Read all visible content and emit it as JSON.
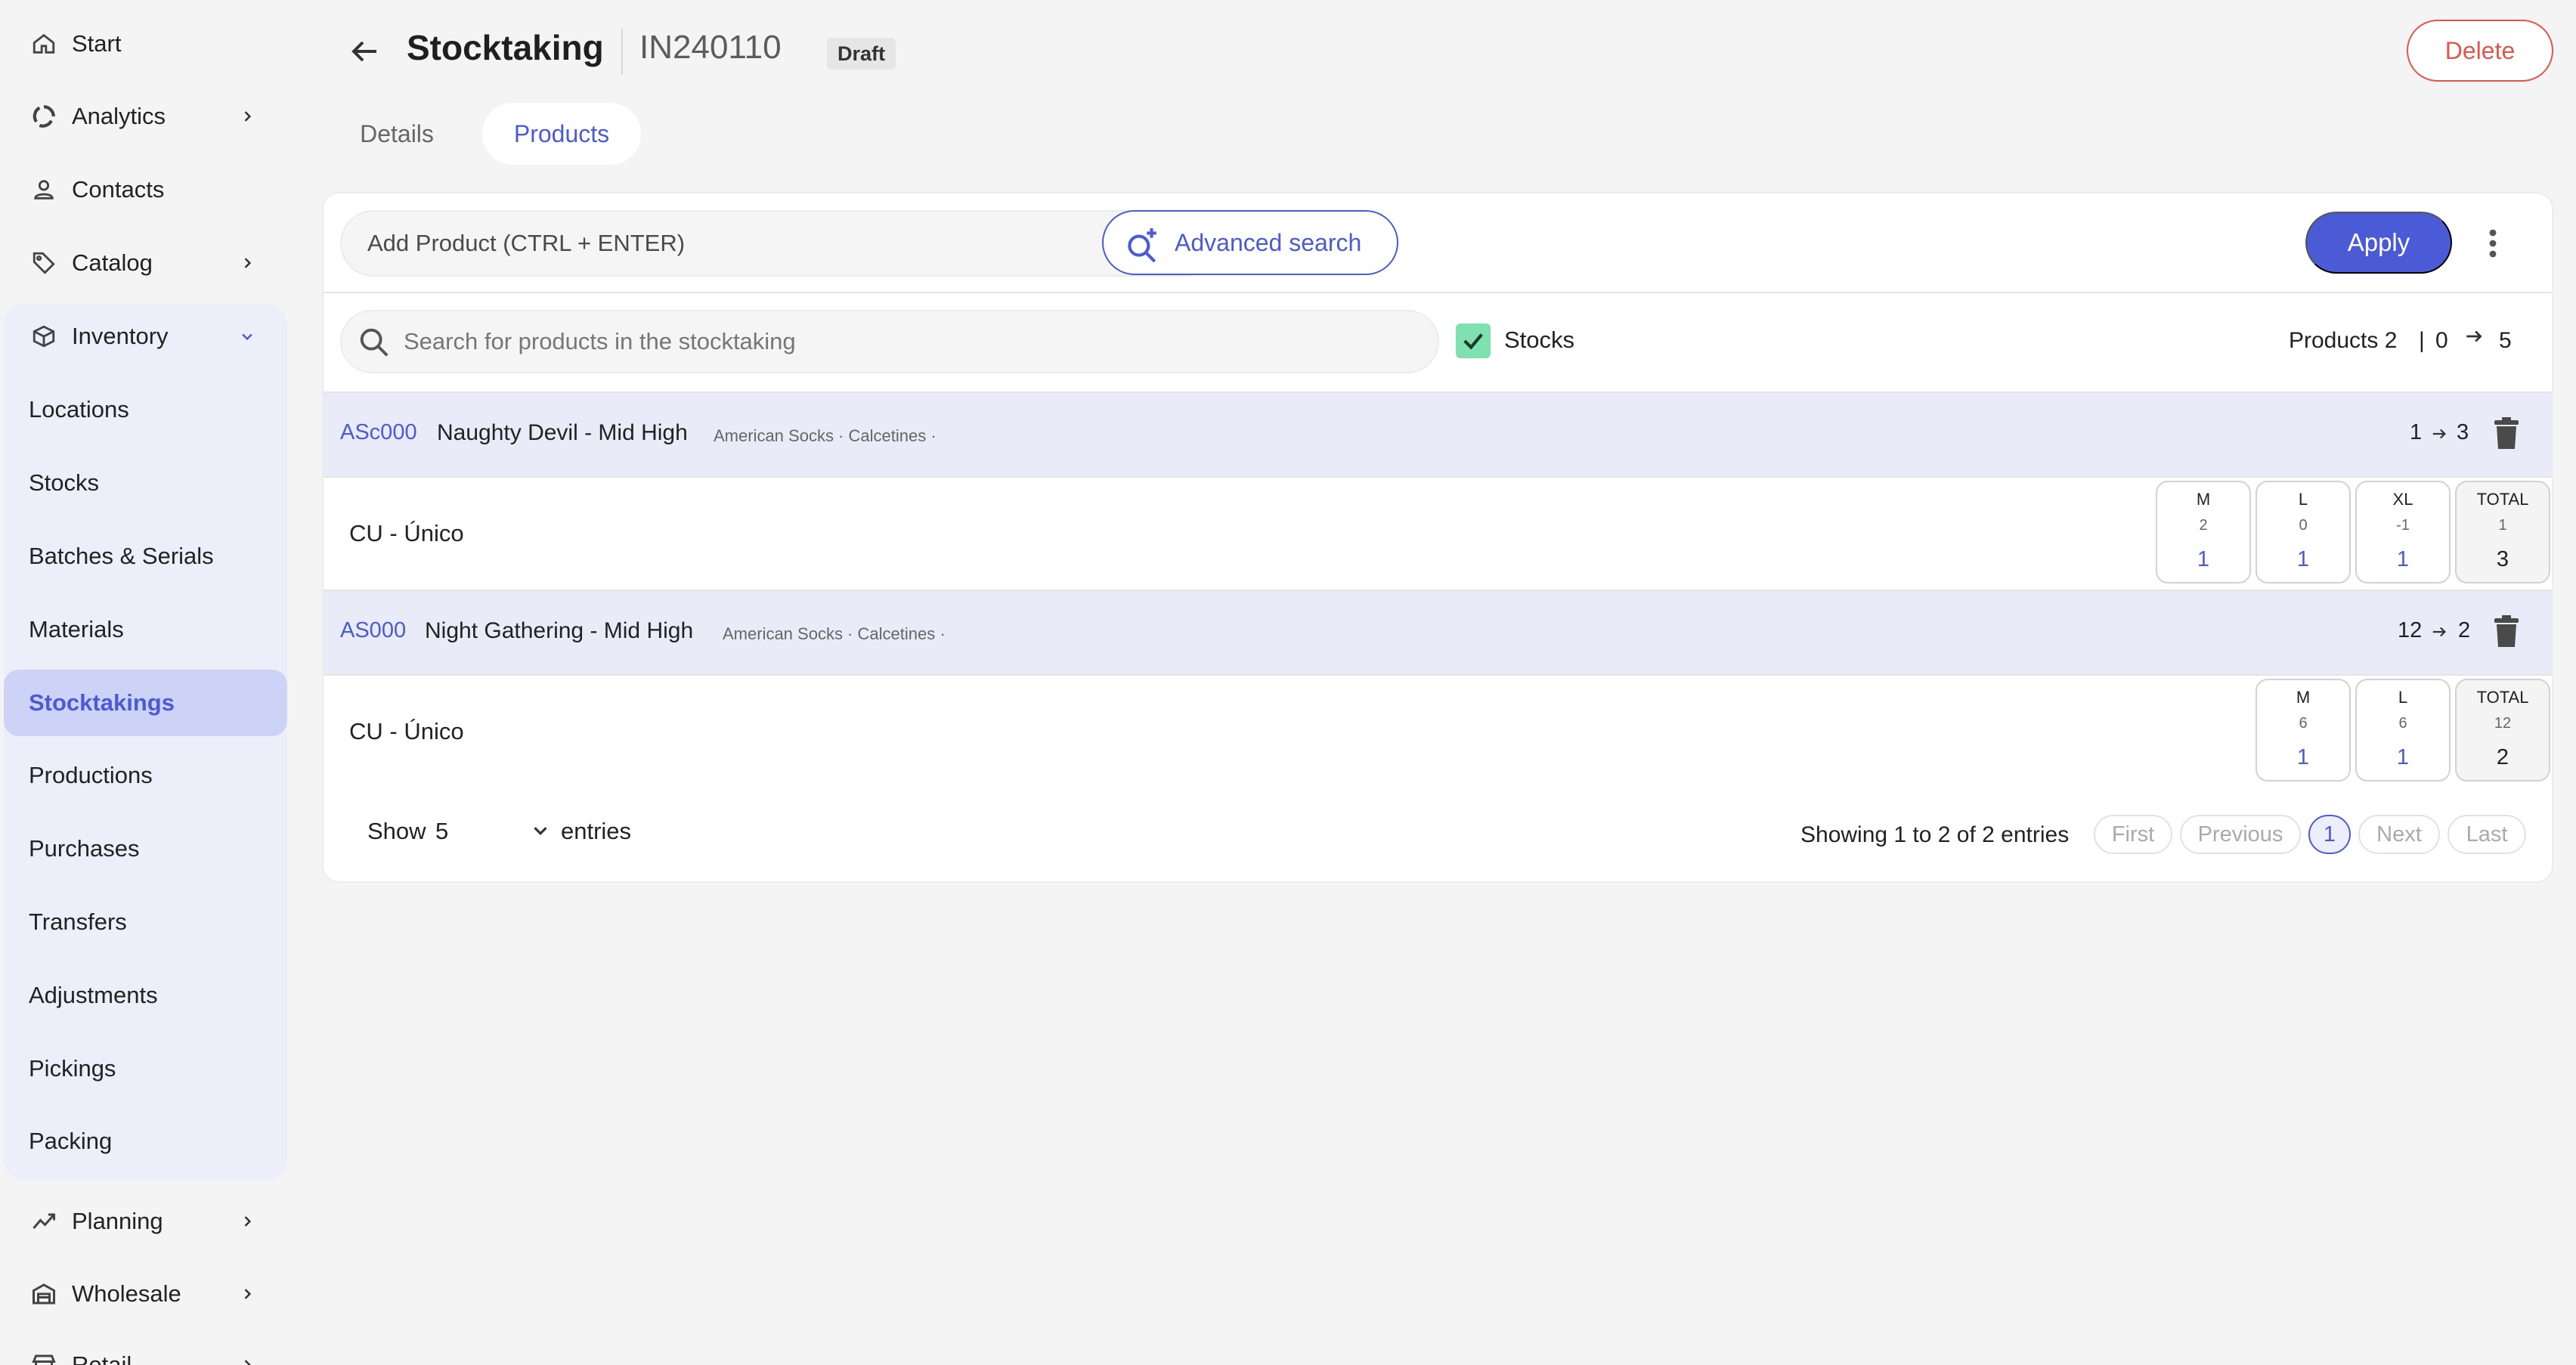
{
  "sidebar": {
    "items": [
      {
        "label": "Start",
        "icon": "home-icon"
      },
      {
        "label": "Analytics",
        "icon": "analytics-icon"
      },
      {
        "label": "Contacts",
        "icon": "user-icon"
      },
      {
        "label": "Catalog",
        "icon": "tag-icon"
      },
      {
        "label": "Inventory",
        "icon": "box-icon"
      }
    ],
    "inventory_items": [
      "Locations",
      "Stocks",
      "Batches & Serials",
      "Materials",
      "Stocktakings",
      "Productions",
      "Purchases",
      "Transfers",
      "Adjustments",
      "Pickings",
      "Packing"
    ],
    "bottom_items": [
      {
        "label": "Planning",
        "icon": "trend-icon"
      },
      {
        "label": "Wholesale",
        "icon": "warehouse-icon"
      },
      {
        "label": "Retail",
        "icon": "store-icon"
      }
    ]
  },
  "header": {
    "title": "Stocktaking",
    "doc_id": "IN240110",
    "status": "Draft",
    "delete_label": "Delete"
  },
  "tabs": [
    "Details",
    "Products"
  ],
  "toolbar": {
    "add_placeholder": "Add Product (CTRL + ENTER)",
    "advanced_search_label": "Advanced search",
    "apply_label": "Apply"
  },
  "filter": {
    "search_placeholder": "Search for products in the stocktaking",
    "stocks_label": "Stocks",
    "stocks_checked": true,
    "summary_label": "Products 2",
    "summary_sep": "|",
    "summary_from": "0",
    "summary_to": "5"
  },
  "products": [
    {
      "sku": "ASc000",
      "name": "Naughty Devil - Mid High",
      "category": "American Socks · Calcetines ·",
      "count_from": "1",
      "count_to": "3",
      "variant": "CU - Único",
      "sizes": [
        {
          "size": "M",
          "stock": "2",
          "count": "1"
        },
        {
          "size": "L",
          "stock": "0",
          "count": "1"
        },
        {
          "size": "XL",
          "stock": "-1",
          "count": "1"
        },
        {
          "size": "TOTAL",
          "stock": "1",
          "count": "3"
        }
      ]
    },
    {
      "sku": "AS000",
      "name": "Night Gathering - Mid High",
      "category": "American Socks · Calcetines ·",
      "count_from": "12",
      "count_to": "2",
      "variant": "CU - Único",
      "sizes": [
        {
          "size": "M",
          "stock": "6",
          "count": "1"
        },
        {
          "size": "L",
          "stock": "6",
          "count": "1"
        },
        {
          "size": "TOTAL",
          "stock": "12",
          "count": "2"
        }
      ]
    }
  ],
  "pagination": {
    "show_label": "Show",
    "page_size": "5",
    "entries_label": "entries",
    "showing_text": "Showing 1 to 2 of 2 entries",
    "first": "First",
    "previous": "Previous",
    "current": "1",
    "next": "Next",
    "last": "Last"
  },
  "colors": {
    "accent": "#4b5bd6",
    "danger": "#e0564b",
    "check": "#7fe0b0",
    "row_highlight": "#e9ebf8"
  }
}
